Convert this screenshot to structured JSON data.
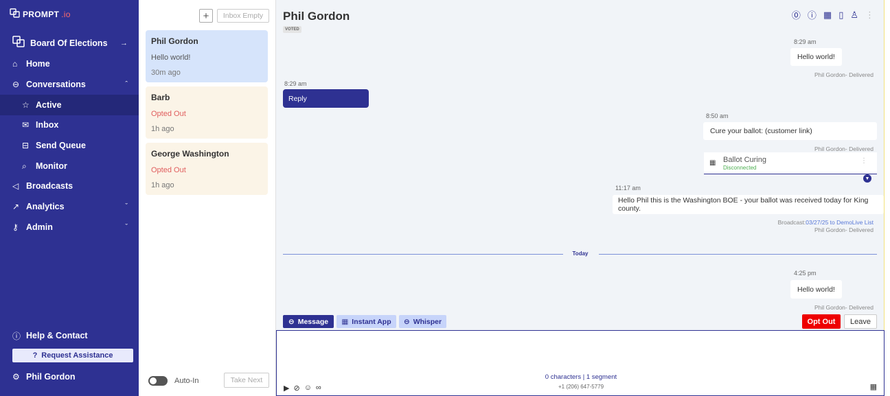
{
  "sidebar": {
    "logo_main": "PROMPT",
    "logo_io": ".io",
    "board_label": "Board Of Elections",
    "nav": {
      "home": "Home",
      "conversations": "Conversations",
      "active": "Active",
      "inbox": "Inbox",
      "send_queue": "Send Queue",
      "monitor": "Monitor",
      "broadcasts": "Broadcasts",
      "analytics": "Analytics",
      "admin": "Admin"
    },
    "help": "Help & Contact",
    "request_assistance": "Request Assistance",
    "user": "Phil Gordon"
  },
  "convlist": {
    "plus": "+",
    "inbox_empty": "Inbox Empty",
    "items": [
      {
        "name": "Phil Gordon",
        "snippet": "Hello world!",
        "time": "30m ago"
      },
      {
        "name": "Barb",
        "snippet": "Opted Out",
        "time": "1h ago"
      },
      {
        "name": "George Washington",
        "snippet": "Opted Out",
        "time": "1h ago"
      }
    ],
    "auto_in": "Auto-In",
    "take_next": "Take Next"
  },
  "chat": {
    "title": "Phil Gordon",
    "badge": "VOTED",
    "messages": [
      {
        "time": "8:29 am",
        "text": "Hello world!",
        "meta": "Phil Gordon- Delivered"
      },
      {
        "time": "8:29 am",
        "text": "Reply"
      },
      {
        "time": "8:50 am",
        "text": "Cure your ballot: (customer link)",
        "meta": "Phil Gordon- Delivered"
      },
      {
        "time": "11:17 am",
        "text": "Hello Phil this is the Washington BOE - your ballot was received today for  King county.",
        "meta_prefix": "Broadcast:",
        "meta_link": "03/27/25 to DemoLive List",
        "meta": "Phil Gordon- Delivered"
      },
      {
        "time": "4:25 pm",
        "text": "Hello world!",
        "meta": "Phil Gordon- Delivered"
      }
    ],
    "app_card": {
      "title": "Ballot Curing",
      "status": "Disconnected"
    },
    "divider": "Today",
    "tabs": {
      "message": "Message",
      "instant_app": "Instant App",
      "whisper": "Whisper"
    },
    "opt_out": "Opt Out",
    "leave": "Leave",
    "composer": {
      "placeholder": "",
      "char_count": "0 characters | 1 segment",
      "phone": "+1 (206) 647-5779"
    }
  },
  "colors": {
    "brand": "#2e3192",
    "danger": "#ee0000",
    "opted_out": "#e05d5d"
  }
}
